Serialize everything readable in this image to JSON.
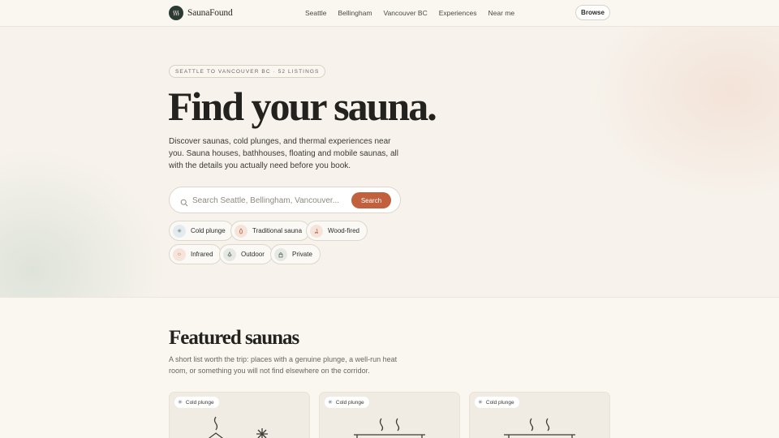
{
  "brand": {
    "name": "SaunaFound"
  },
  "nav": {
    "links": [
      "Seattle",
      "Bellingham",
      "Vancouver BC",
      "Experiences",
      "Near me"
    ],
    "browse_label": "Browse"
  },
  "hero": {
    "tag": "SEATTLE TO VANCOUVER BC · 52 LISTINGS",
    "title": "Find your sauna.",
    "description": "Discover saunas, cold plunges, and thermal experiences near you. Sauna houses, bathhouses, floating and mobile saunas, all with the details you actually need before you book.",
    "search": {
      "placeholder": "Search Seattle, Bellingham, Vancouver...",
      "value": "",
      "button_label": "Search"
    },
    "chips": [
      {
        "label": "Cold plunge",
        "icon": "snowflake-icon"
      },
      {
        "label": "Traditional sauna",
        "icon": "flame-icon"
      },
      {
        "label": "Wood-fired",
        "icon": "wood-fire-icon"
      },
      {
        "label": "Infrared",
        "icon": "sun-icon"
      },
      {
        "label": "Outdoor",
        "icon": "tree-icon"
      },
      {
        "label": "Private",
        "icon": "lock-icon"
      }
    ]
  },
  "featured": {
    "title": "Featured saunas",
    "description": "A short list worth the trip: places with a genuine plunge, a well-run heat room, or something you will not find elsewhere on the corridor.",
    "cards": [
      {
        "badge": "Cold plunge",
        "illustration": "sauna-cabin-snowflake-icon"
      },
      {
        "badge": "Cold plunge",
        "illustration": "sauna-bench-steam-icon"
      },
      {
        "badge": "Cold plunge",
        "illustration": "sauna-bench-steam-icon"
      }
    ]
  },
  "colors": {
    "accent": "#c0603d",
    "background": "#faf7f1",
    "logo": "#2c3a34"
  }
}
